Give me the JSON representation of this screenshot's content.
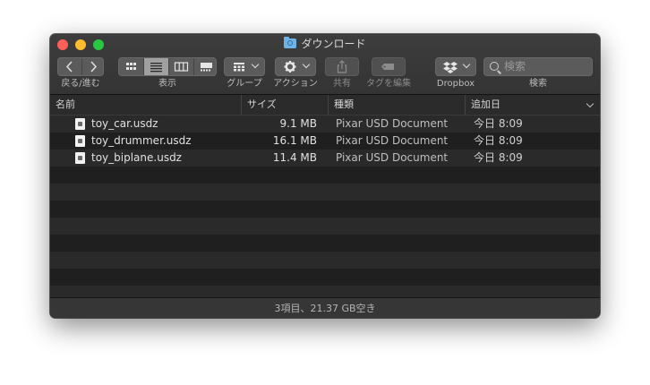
{
  "window": {
    "title": "ダウンロード"
  },
  "toolbar": {
    "back_forward_label": "戻る/進む",
    "view_label": "表示",
    "group_label": "グループ",
    "action_label": "アクション",
    "share_label": "共有",
    "tag_label": "タグを編集",
    "dropbox_label": "Dropbox",
    "search_label": "検索",
    "search_placeholder": "検索"
  },
  "columns": {
    "name": "名前",
    "size": "サイズ",
    "kind": "種類",
    "date_added": "追加日"
  },
  "files": [
    {
      "name": "toy_car.usdz",
      "size": "9.1 MB",
      "kind": "Pixar USD Document",
      "date": "今日 8:09"
    },
    {
      "name": "toy_drummer.usdz",
      "size": "16.1 MB",
      "kind": "Pixar USD Document",
      "date": "今日 8:09"
    },
    {
      "name": "toy_biplane.usdz",
      "size": "11.4 MB",
      "kind": "Pixar USD Document",
      "date": "今日 8:09"
    }
  ],
  "status": {
    "text": "3項目、21.37 GB空き"
  },
  "icons": {
    "folder": "folder-icon",
    "back": "chevron-left-icon",
    "forward": "chevron-right-icon",
    "view_icons": "grid-icon",
    "view_list": "list-icon",
    "view_columns": "columns-icon",
    "view_gallery": "gallery-icon",
    "group": "group-icon",
    "action": "gear-icon",
    "share": "share-icon",
    "tag": "tag-icon",
    "dropbox": "dropbox-icon",
    "search": "search-icon"
  }
}
